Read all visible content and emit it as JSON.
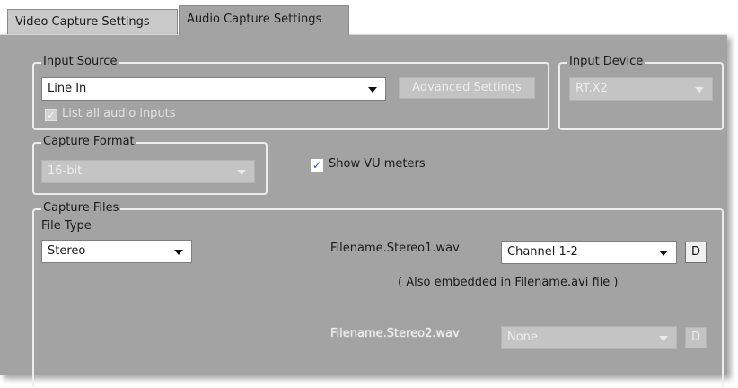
{
  "tabs": [
    {
      "label": "Video Capture Settings",
      "active": false
    },
    {
      "label": "Audio Capture Settings",
      "active": true
    }
  ],
  "input_source": {
    "legend": "Input Source",
    "source_value": "Line In",
    "advanced_settings_label": "Advanced Settings",
    "list_all_label": "List all audio inputs",
    "list_all_checked": true
  },
  "input_device": {
    "legend": "Input Device",
    "value": "RT.X2"
  },
  "capture_format": {
    "legend": "Capture Format",
    "value": "16-bit"
  },
  "show_vu": {
    "label": "Show VU meters",
    "checked": true
  },
  "capture_files": {
    "legend": "Capture Files",
    "file_type_label": "File Type",
    "file_type_value": "Stereo",
    "file1": {
      "name": "Filename.Stereo1.wav",
      "channel": "Channel 1-2",
      "d_label": "D"
    },
    "embedded_note": "( Also embedded in Filename.avi file )",
    "file2": {
      "name": "Filename.Stereo2.wav",
      "channel": "None",
      "d_label": "D"
    }
  },
  "colors": {
    "panel_bg": "#a3a3a3",
    "group_border": "#ececec",
    "check_accent": "#1f4ed0"
  }
}
